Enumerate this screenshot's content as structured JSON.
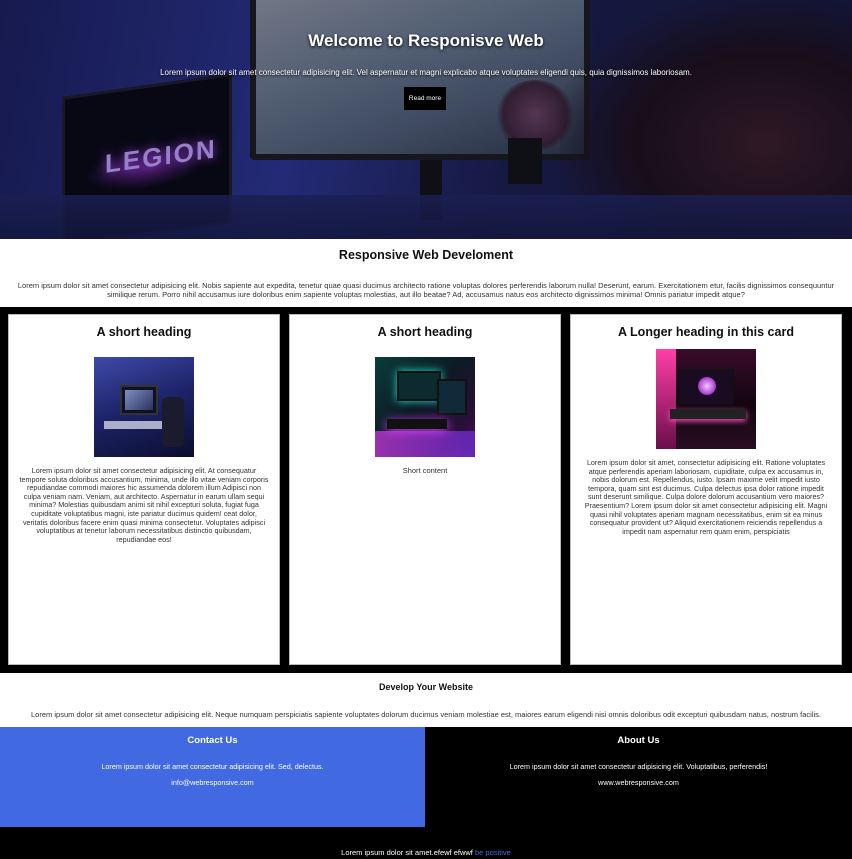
{
  "hero": {
    "title": "Welcome to Responisve Web",
    "text": "Lorem ipsum dolor sit amet consectetur adipisicing elit. Vel aspernatur et magni explicabo atque voluptates eligendi quis, quia dignissimos laboriosam.",
    "button_label": "Read more",
    "laptop_logo": "LEGION"
  },
  "intro": {
    "title": "Responsive Web Develoment",
    "text": "Lorem ipsum dolor sit amet consectetur adipisicing elit. Nobis sapiente aut expedita, tenetur quae quasi ducimus architecto ratione voluptas dolores perferendis laborum nulla! Deserunt, earum. Exercitationem etur, facilis dignissimos consequuntur similique rerum. Porro nihil accusamus iure doloribus enim sapiente voluptas molestias, aut illo beatae? Ad, accusamus natus eos architecto dignissimos minima! Omnis pariatur impedit atque?"
  },
  "cards": [
    {
      "heading": "A short heading",
      "text": "Lorem ipsum dolor sit amet consectetur adipisicing elit. At consequatur tempore soluta doloribus accusantium, minima, unde illo vitae veniam corporis repudiandae commodi maiores hic assumenda dolorem illum Adipisci non culpa veniam nam. Veniam, aut architecto. Aspernatur in earum ullam sequi minima? Molestias quibusdam animi sit nihil excepturi soluta, fugiat fuga cupiditate voluptatibus magni, iste pariatur ducimus quidem! ceat dolor, veritatis doloribus facere enim quasi minima consectetur. Voluptates adipisci voluptatibus at tenetur laborum necessitatibus distinctio quibusdam, repudiandae eos!"
    },
    {
      "heading": "A short heading",
      "text": "Short content"
    },
    {
      "heading": "A Longer heading in this card",
      "text": "Lorem ipsum dolor sit amet, consectetur adipisicing elit. Ratione voluptates atque perferendis aperiam laboriosam, cupiditate, culpa ex accusamus in, nobis dolorum est. Repellendus, iusto. Ipsam maxime velit impedit iusto tempora, quam sint est ducimus. Culpa delectus ipsa dolor ratione impedit sunt deserunt similique. Culpa dolore dolorum accusantium vero maiores? Praesentium? Lorem ipsum dolor sit amet consectetur adipisicing elit. Magni quasi nihil voluptates aperiam magnam necessitatibus, enim sit ea minus consequatur provident ut? Aliquid exercitationem reiciendis repellendus a impedit nam aspernatur rem quam enim, perspiciatis"
    }
  ],
  "develop": {
    "title": "Develop Your Website",
    "text": "Lorem ipsum dolor sit amet consectetur adipisicing elit. Neque numquam perspiciatis sapiente voluptates dolorum ducimus veniam molestiae est, maiores earum eligendi nisi omnis doloribus odit excepturi quibusdam natus, nostrum facilis."
  },
  "contact": {
    "title": "Contact Us",
    "text": "Lorem ipsum dolor sit amet consectetur adipisicing elit. Sed, delectus.",
    "email": "info@webresponsive.com"
  },
  "about": {
    "title": "About Us",
    "text": "Lorem ipsum dolor sit amet consectetur adipisicing elit. Voluptatibus, perferendis!",
    "website": "www.webresponsive.com"
  },
  "footer": {
    "text": "Lorem ipsum dolor sit amet.efewf efwwf",
    "link_label": "be positive"
  },
  "colors": {
    "accent": "#4169e1",
    "dark": "#000000"
  }
}
